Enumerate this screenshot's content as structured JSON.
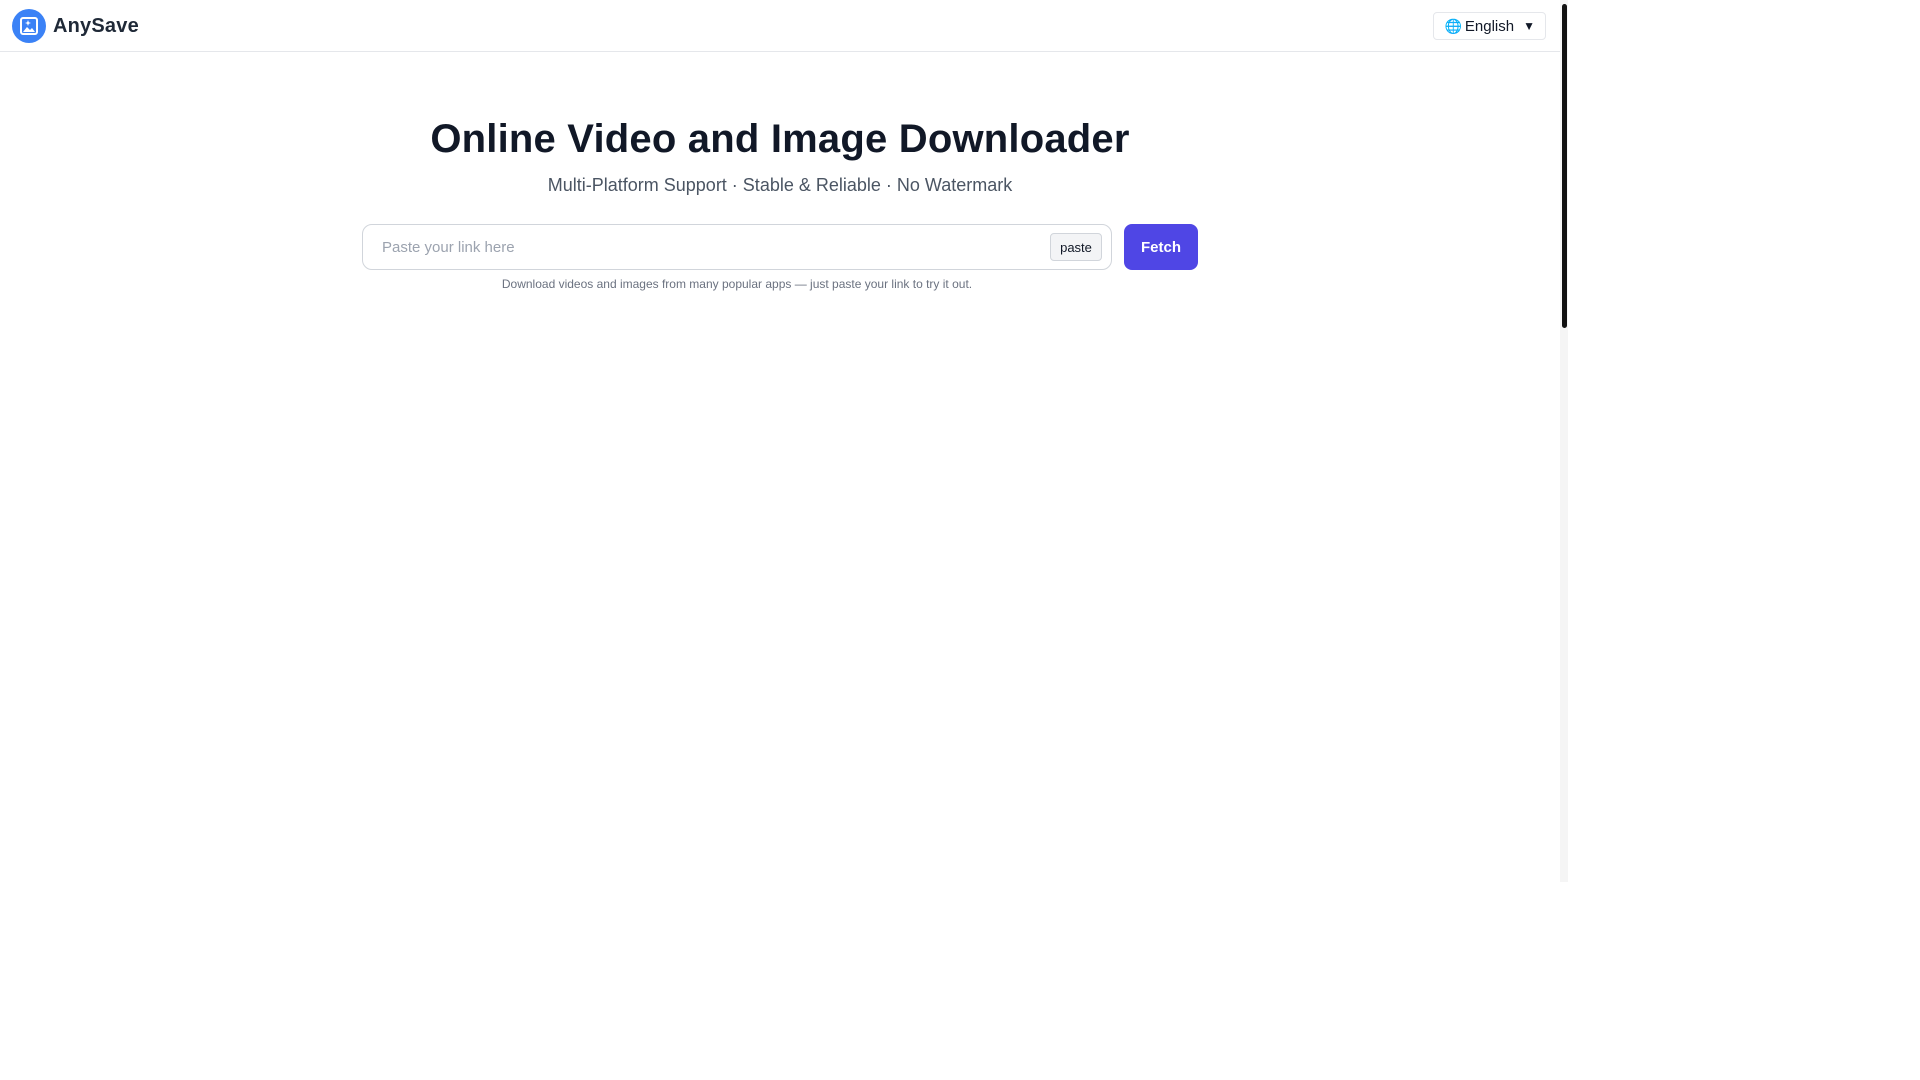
{
  "header": {
    "brand_name": "AnySave",
    "logo_icon": "image-sparkle-icon",
    "language": {
      "icon": "globe-icon",
      "label": "English",
      "caret": "▼"
    }
  },
  "hero": {
    "title": "Online Video and Image Downloader",
    "subtitle": "Multi-Platform Support · Stable & Reliable · No Watermark"
  },
  "search": {
    "placeholder": "Paste your link here",
    "value": "",
    "paste_label": "paste",
    "fetch_label": "Fetch",
    "hint": "Download videos and images from many popular apps — just paste your link to try it out."
  },
  "colors": {
    "accent": "#4f46e5",
    "logo": "#3b82f6",
    "title": "#111827",
    "subtitle": "#4b5563"
  }
}
